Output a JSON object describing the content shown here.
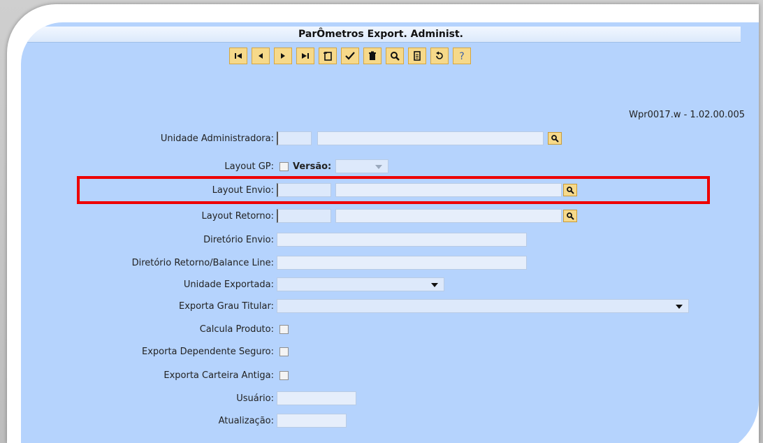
{
  "title": "ParÔmetros Export. Administ.",
  "toolbar": {
    "buttons": [
      {
        "icon": "first-record-icon"
      },
      {
        "icon": "previous-record-icon"
      },
      {
        "icon": "next-record-icon"
      },
      {
        "icon": "last-record-icon"
      },
      {
        "icon": "new-record-icon"
      },
      {
        "icon": "confirm-icon"
      },
      {
        "icon": "delete-icon"
      },
      {
        "icon": "search-icon"
      },
      {
        "icon": "report-icon"
      },
      {
        "icon": "undo-icon"
      },
      {
        "icon": "help-icon"
      }
    ]
  },
  "program_version": "Wpr0017.w - 1.02.00.005",
  "form": {
    "unidade_administradora": {
      "label": "Unidade Administradora:",
      "code": "",
      "name": ""
    },
    "layout_gp": {
      "label": "Layout GP:",
      "checked": false
    },
    "versao": {
      "label": "Versão:",
      "value": ""
    },
    "layout_envio": {
      "label": "Layout Envio:",
      "code": "",
      "name": ""
    },
    "layout_retorno": {
      "label": "Layout Retorno:",
      "code": "",
      "name": ""
    },
    "diretorio_envio": {
      "label": "Diretório Envio:",
      "value": ""
    },
    "diretorio_retorno": {
      "label": "Diretório Retorno/Balance Line:",
      "value": ""
    },
    "unidade_exportada": {
      "label": "Unidade Exportada:",
      "value": ""
    },
    "exporta_grau_titular": {
      "label": "Exporta Grau Titular:",
      "value": ""
    },
    "calcula_produto": {
      "label": "Calcula Produto:",
      "checked": false
    },
    "exporta_dependente_seguro": {
      "label": "Exporta Dependente Seguro:",
      "checked": false
    },
    "exporta_carteira_antiga": {
      "label": "Exporta Carteira Antiga:",
      "checked": false
    },
    "usuario": {
      "label": "Usuário:",
      "value": ""
    },
    "atualizacao": {
      "label": "Atualização:",
      "value": ""
    }
  },
  "colors": {
    "panel": "#b5d3fd",
    "button": "#f6d98a",
    "highlight": "#ee0000"
  }
}
